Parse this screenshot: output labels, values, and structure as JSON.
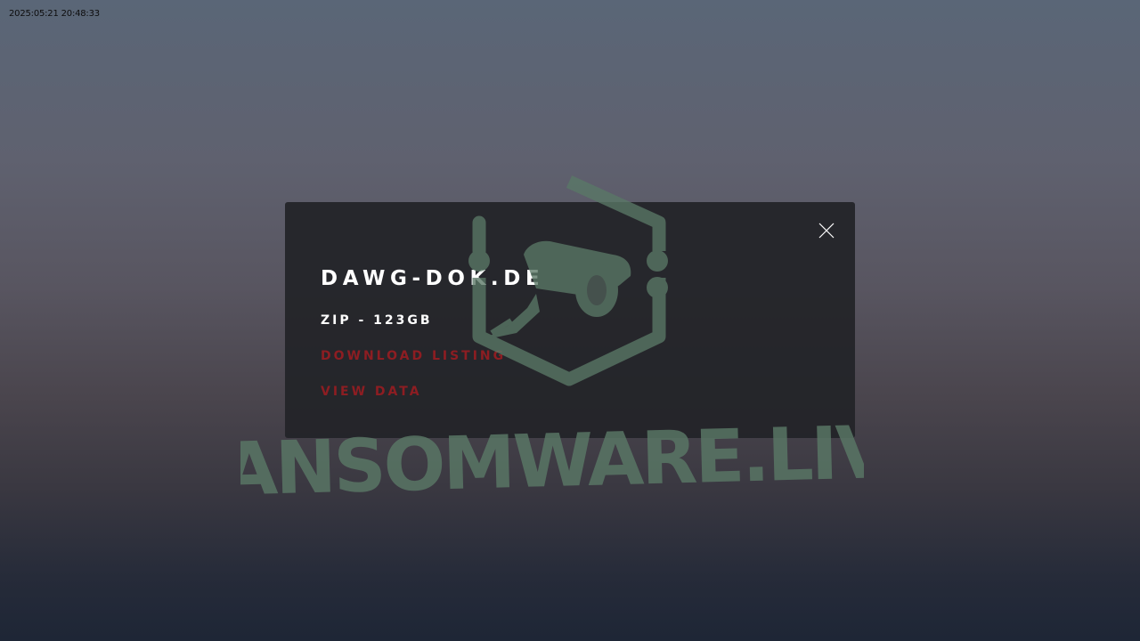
{
  "timestamp": "2025:05:21 20:48:33",
  "modal": {
    "title": "DAWG-DOK.DE",
    "subtitle": "ZIP - 123GB",
    "download_label": "DOWNLOAD LISTING",
    "view_label": "VIEW DATA",
    "close_icon": "close-icon",
    "link_color": "#8d1d22"
  },
  "watermark": {
    "text": "RANSOMWARE.LIVE",
    "icon": "security-camera-hexagon-logo",
    "color": "#5d7a69"
  }
}
